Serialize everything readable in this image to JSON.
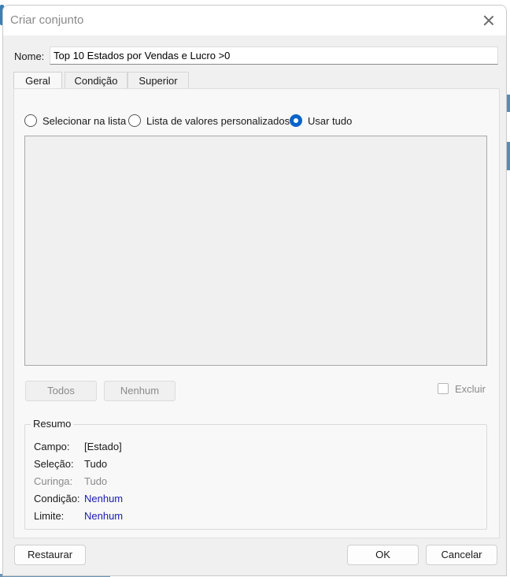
{
  "window": {
    "title": "Criar conjunto"
  },
  "name": {
    "label": "Nome:",
    "value": "Top 10 Estados por Vendas e Lucro >0"
  },
  "tabs": [
    {
      "label": "Geral",
      "active": true
    },
    {
      "label": "Condição",
      "active": false
    },
    {
      "label": "Superior",
      "active": false
    }
  ],
  "radios": [
    {
      "label": "Selecionar na lista",
      "checked": false
    },
    {
      "label": "Lista de valores personalizados",
      "checked": false
    },
    {
      "label": "Usar tudo",
      "checked": true
    }
  ],
  "list_buttons": {
    "all": "Todos",
    "none": "Nenhum"
  },
  "exclude": {
    "label": "Excluir",
    "checked": false
  },
  "summary": {
    "title": "Resumo",
    "rows": [
      {
        "key": "Campo:",
        "value": "[Estado]"
      },
      {
        "key": "Seleção:",
        "value": "Tudo"
      },
      {
        "key": "Curinga:",
        "value": "Tudo"
      },
      {
        "key": "Condição:",
        "value": "Nenhum"
      },
      {
        "key": "Limite:",
        "value": "Nenhum"
      }
    ]
  },
  "footer": {
    "reset": "Restaurar",
    "ok": "OK",
    "cancel": "Cancelar"
  },
  "colors": {
    "accent": "#0a64c8",
    "link": "#1a1ab4"
  }
}
